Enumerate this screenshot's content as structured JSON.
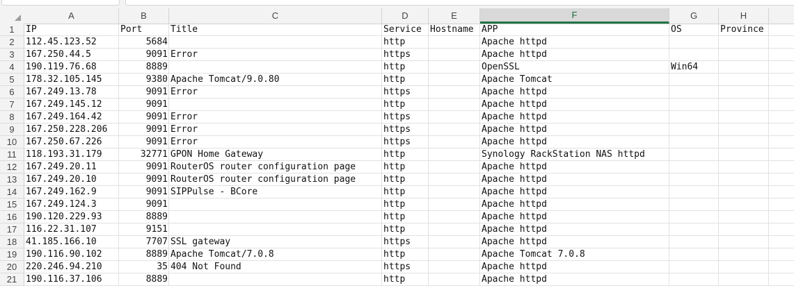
{
  "columns": [
    "A",
    "B",
    "C",
    "D",
    "E",
    "F",
    "G",
    "H"
  ],
  "selected_column": "F",
  "rows": [
    [
      "IP",
      "Port",
      "Title",
      "Service",
      "Hostname",
      "APP",
      "OS",
      "Province"
    ],
    [
      "112.45.123.52",
      "5684",
      "",
      "http",
      "",
      "Apache httpd",
      "",
      ""
    ],
    [
      "167.250.44.5",
      "9091",
      "Error",
      "https",
      "",
      "Apache httpd",
      "",
      ""
    ],
    [
      "190.119.76.68",
      "8889",
      "",
      "http",
      "",
      "OpenSSL",
      "Win64",
      ""
    ],
    [
      "178.32.105.145",
      "9380",
      "Apache Tomcat/9.0.80",
      "http",
      "",
      "Apache Tomcat",
      "",
      ""
    ],
    [
      "167.249.13.78",
      "9091",
      "Error",
      "https",
      "",
      "Apache httpd",
      "",
      ""
    ],
    [
      "167.249.145.12",
      "9091",
      "",
      "http",
      "",
      "Apache httpd",
      "",
      ""
    ],
    [
      "167.249.164.42",
      "9091",
      "Error",
      "https",
      "",
      "Apache httpd",
      "",
      ""
    ],
    [
      "167.250.228.206",
      "9091",
      "Error",
      "https",
      "",
      "Apache httpd",
      "",
      ""
    ],
    [
      "167.250.67.226",
      "9091",
      "Error",
      "https",
      "",
      "Apache httpd",
      "",
      ""
    ],
    [
      "118.193.31.179",
      "32771",
      "GPON Home Gateway",
      "http",
      "",
      "Synology RackStation NAS httpd",
      "",
      ""
    ],
    [
      "167.249.20.11",
      "9091",
      "RouterOS router configuration page",
      "http",
      "",
      "Apache httpd",
      "",
      ""
    ],
    [
      "167.249.20.10",
      "9091",
      "RouterOS router configuration page",
      "http",
      "",
      "Apache httpd",
      "",
      ""
    ],
    [
      "167.249.162.9",
      "9091",
      "SIPPulse - BCore",
      "http",
      "",
      "Apache httpd",
      "",
      ""
    ],
    [
      "167.249.124.3",
      "9091",
      "",
      "http",
      "",
      "Apache httpd",
      "",
      ""
    ],
    [
      "190.120.229.93",
      "8889",
      "",
      "http",
      "",
      "Apache httpd",
      "",
      ""
    ],
    [
      "116.22.31.107",
      "9151",
      "",
      "http",
      "",
      "Apache httpd",
      "",
      ""
    ],
    [
      "41.185.166.10",
      "7707",
      "SSL gateway",
      "https",
      "",
      "Apache httpd",
      "",
      ""
    ],
    [
      "190.116.90.102",
      "8889",
      "Apache Tomcat/7.0.8",
      "http",
      "",
      "Apache Tomcat 7.0.8",
      "",
      ""
    ],
    [
      "220.246.94.210",
      "35",
      "404 Not Found",
      "https",
      "",
      "Apache httpd",
      "",
      ""
    ],
    [
      "190.116.37.106",
      "8889",
      "",
      "http",
      "",
      "Apache httpd",
      "",
      ""
    ]
  ]
}
